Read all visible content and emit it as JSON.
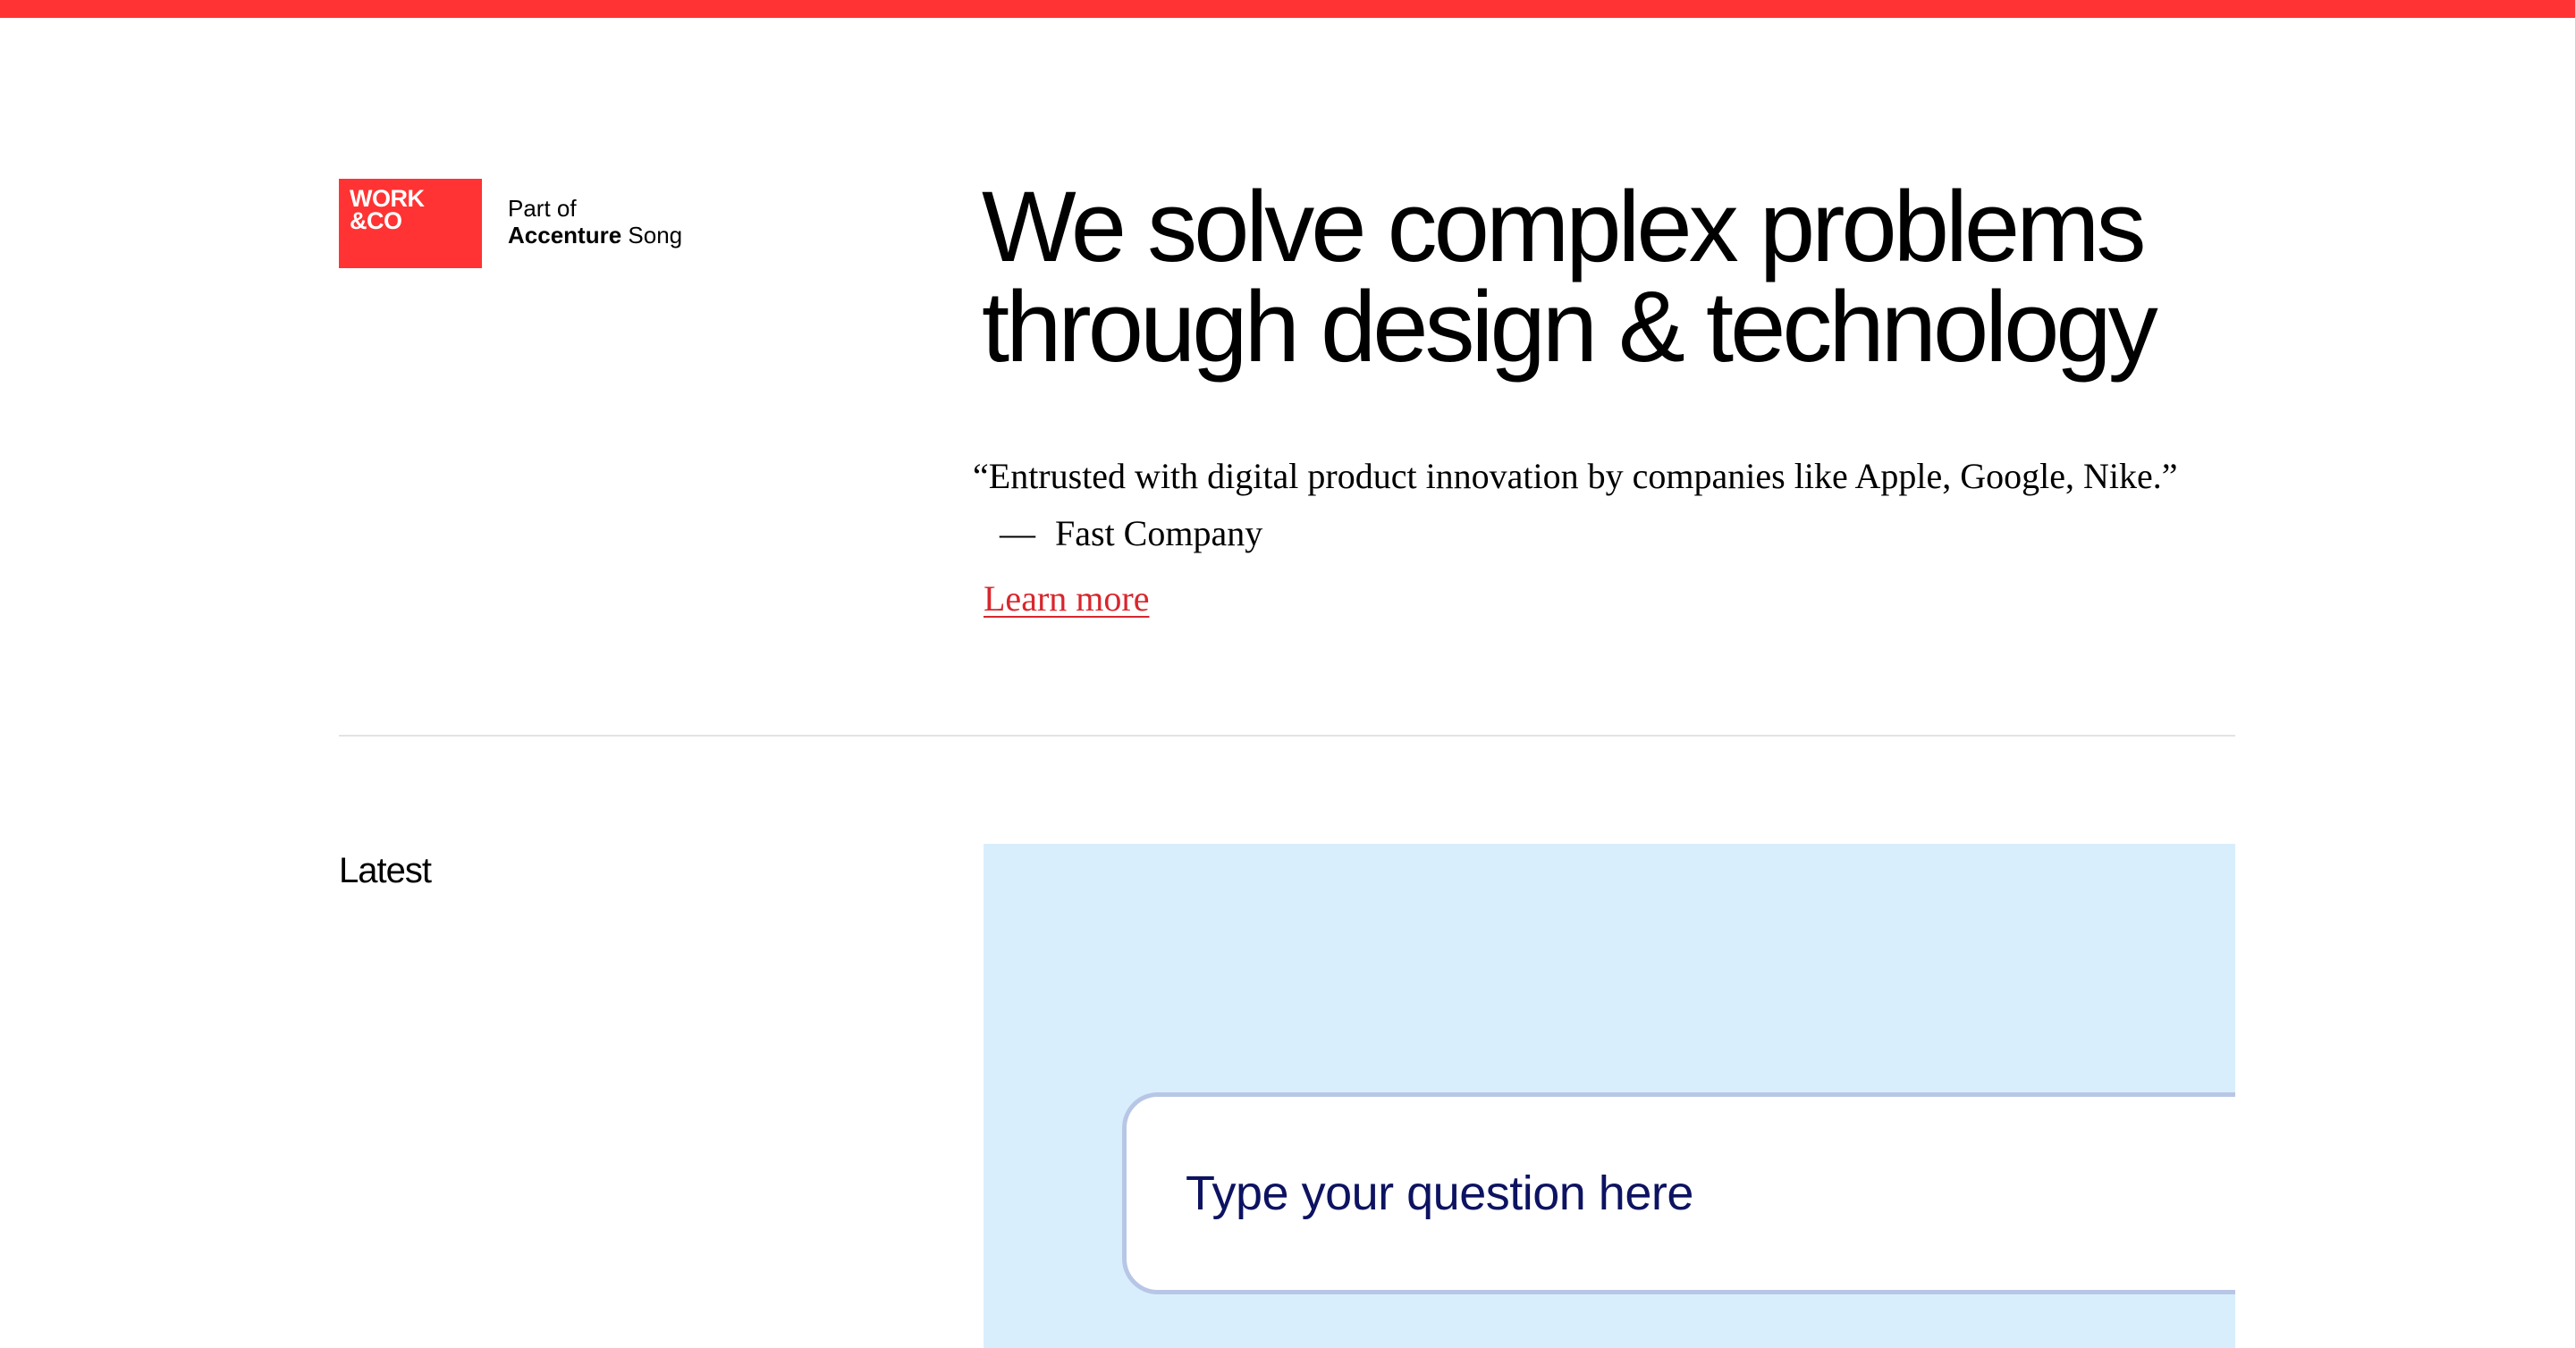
{
  "colors": {
    "accent": "#ff3333",
    "text": "#000000",
    "link": "#d8262d",
    "card_background": "#d9eefc",
    "question_text": "#0d1361"
  },
  "header": {
    "logo_line1": "WORK",
    "logo_line2": "&CO",
    "tagline_part": "Part of",
    "tagline_brand": "Accenture",
    "tagline_suffix": "Song"
  },
  "hero": {
    "headline_line1": "We solve complex problems",
    "headline_line2": "through design & technology",
    "quote": "“Entrusted with digital product innovation by companies like Apple, Google, Nike.”",
    "attribution_dash": "—",
    "attribution_source": "Fast Company",
    "learn_more": "Learn more"
  },
  "latest": {
    "label": "Latest",
    "question_placeholder": "Type your question here"
  }
}
